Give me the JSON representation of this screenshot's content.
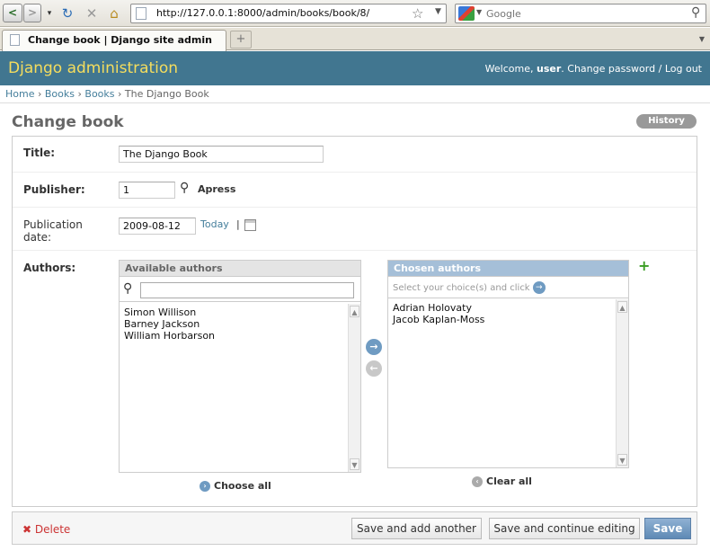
{
  "browser": {
    "back_label": "<",
    "forward_label": ">",
    "url": "http://127.0.0.1:8000/admin/books/book/8/",
    "search_placeholder": "Google",
    "tab_title": "Change book | Django site admin",
    "new_tab_label": "+"
  },
  "header": {
    "brand": "Django administration",
    "welcome": "Welcome,",
    "user": "user",
    "change_password": "Change password",
    "separator": "/",
    "logout": "Log out"
  },
  "breadcrumbs": {
    "items": [
      "Home",
      "Books",
      "Books"
    ],
    "current": "The Django Book",
    "separator": "›"
  },
  "page": {
    "title": "Change book",
    "history_label": "History"
  },
  "form": {
    "title": {
      "label": "Title:",
      "value": "The Django Book"
    },
    "publisher": {
      "label": "Publisher:",
      "value": "1",
      "display": "Apress"
    },
    "publication_date": {
      "label_line1": "Publication",
      "label_line2": "date:",
      "value": "2009-08-12",
      "today": "Today",
      "pipe": "|"
    },
    "authors": {
      "label": "Authors:",
      "available_title": "Available authors",
      "available": [
        "Simon Willison",
        "Barney Jackson",
        "William Horbarson"
      ],
      "chosen_title": "Chosen authors",
      "chosen_hint": "Select your choice(s) and click",
      "chosen": [
        "Adrian Holovaty",
        "Jacob Kaplan-Moss"
      ],
      "choose_all": "Choose all",
      "clear_all": "Clear all"
    }
  },
  "submit": {
    "delete": "Delete",
    "save_add": "Save and add another",
    "save_continue": "Save and continue editing",
    "save": "Save"
  },
  "colors": {
    "header_bg": "#417690",
    "brand": "#f5dd5d",
    "link": "#447e9b",
    "delete": "#cc3434"
  }
}
